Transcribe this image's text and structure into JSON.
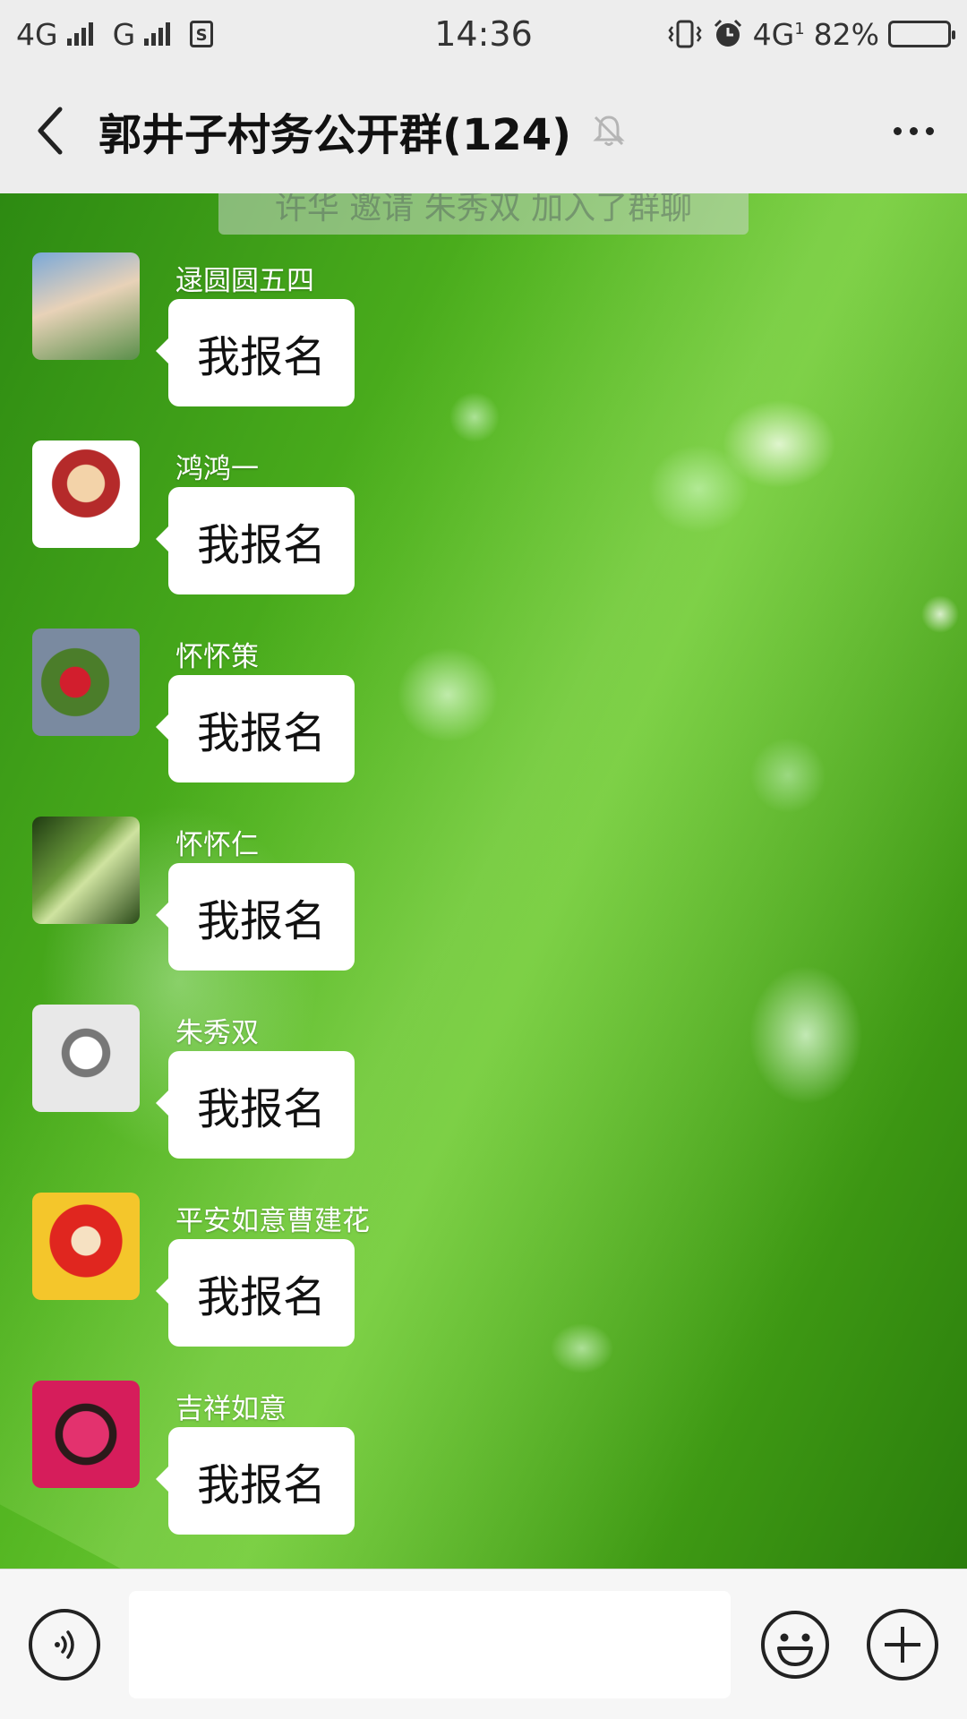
{
  "status_bar": {
    "network_1": "4G",
    "network_2": "G",
    "sim_icon": "sim-card-icon",
    "time": "14:36",
    "network_3": "4G",
    "network_3_sub": "1",
    "battery_percent": "82%",
    "battery_level": 0.82
  },
  "header": {
    "title": "郭井子村务公开群(124)",
    "back_icon": "chevron-left-icon",
    "mute_icon": "bell-muted-icon",
    "more_icon": "more-dots-icon"
  },
  "chat": {
    "system_notice": "许华 邀请 朱秀双 加入了群聊",
    "messages": [
      {
        "sender": "逯圆圆五四",
        "text": "我报名"
      },
      {
        "sender": "鸿鸿一",
        "text": "我报名"
      },
      {
        "sender": "怀怀策",
        "text": "我报名"
      },
      {
        "sender": "怀怀仁",
        "text": "我报名"
      },
      {
        "sender": "朱秀双",
        "text": "我报名"
      },
      {
        "sender": "平安如意曹建花",
        "text": "我报名"
      },
      {
        "sender": "吉祥如意",
        "text": "我报名"
      }
    ]
  },
  "input_bar": {
    "input_value": "",
    "voice_icon": "voice-icon",
    "emoji_icon": "emoji-icon",
    "plus_icon": "plus-icon"
  }
}
